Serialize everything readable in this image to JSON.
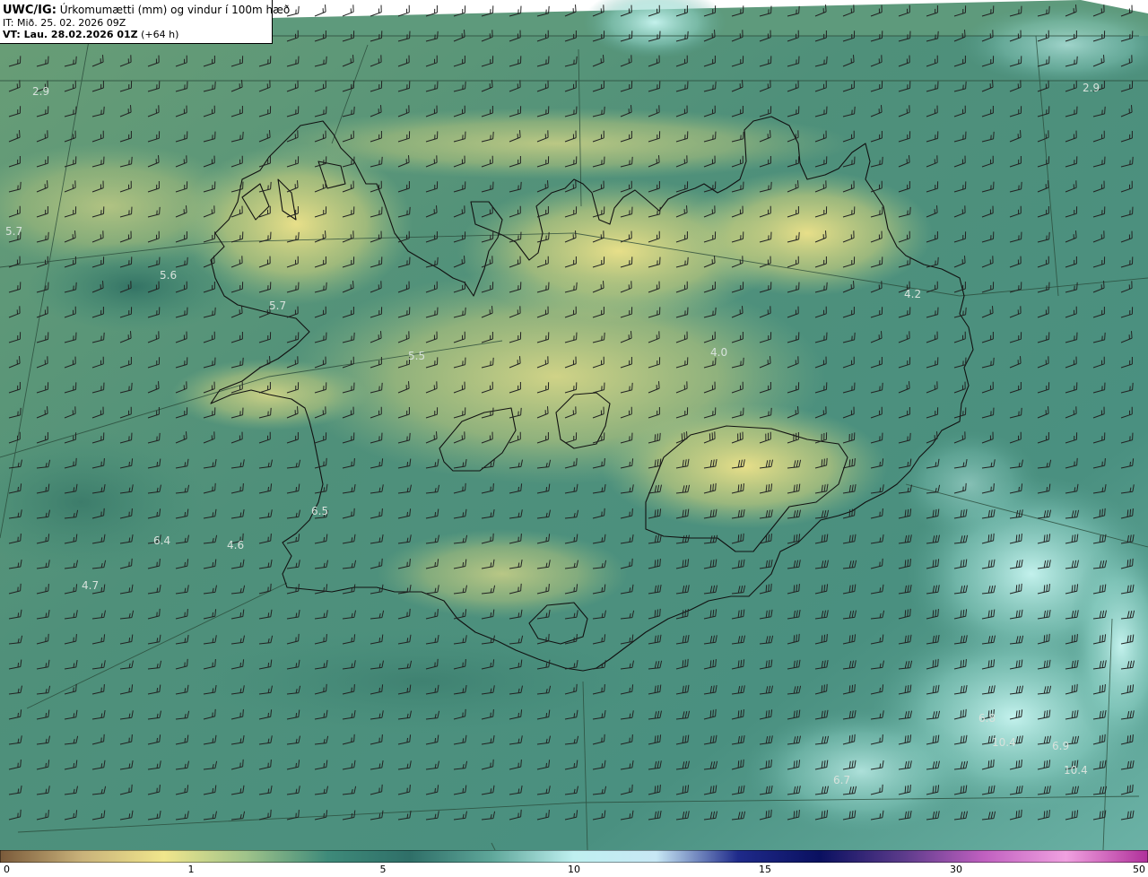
{
  "title": {
    "product": "UWC/IG:",
    "description": "Úrkomumætti (mm) og vindur í 100m hæð",
    "init_time": "IT: Mið. 25. 02. 2026 09Z",
    "valid_prefix": "VT: Lau. 28.02.2026 01Z",
    "valid_suffix": "(+64 h)"
  },
  "colorbar": {
    "ticks": [
      "0",
      "1",
      "5",
      "10",
      "15",
      "30",
      "50"
    ],
    "stops": [
      "#7a5a3a",
      "#c9b27a",
      "#f0e68c",
      "#9fc38a",
      "#3e8a7a",
      "#2f6f68",
      "#5fa79a",
      "#bff0f0",
      "#c8e8f5",
      "#1f2a8a",
      "#0a1060",
      "#5a3a8a",
      "#c060c0",
      "#f0a0e0",
      "#b0309a"
    ]
  },
  "value_labels": [
    {
      "text": "2.9"
    },
    {
      "text": "2.9"
    },
    {
      "text": "5.7"
    },
    {
      "text": "5.6"
    },
    {
      "text": "5.7"
    },
    {
      "text": "5.5"
    },
    {
      "text": "4.0"
    },
    {
      "text": "4.2"
    },
    {
      "text": "6.5"
    },
    {
      "text": "6.4"
    },
    {
      "text": "4.6"
    },
    {
      "text": "4.7"
    },
    {
      "text": "6.8"
    },
    {
      "text": "6.9"
    },
    {
      "text": "6.7"
    },
    {
      "text": "10.4"
    },
    {
      "text": "10.4"
    }
  ],
  "colors": {
    "dry": "#e8e08a",
    "moist": "#3f8a78",
    "wet": "#bff0ee",
    "coast": "#111111",
    "barb": "#222222"
  }
}
